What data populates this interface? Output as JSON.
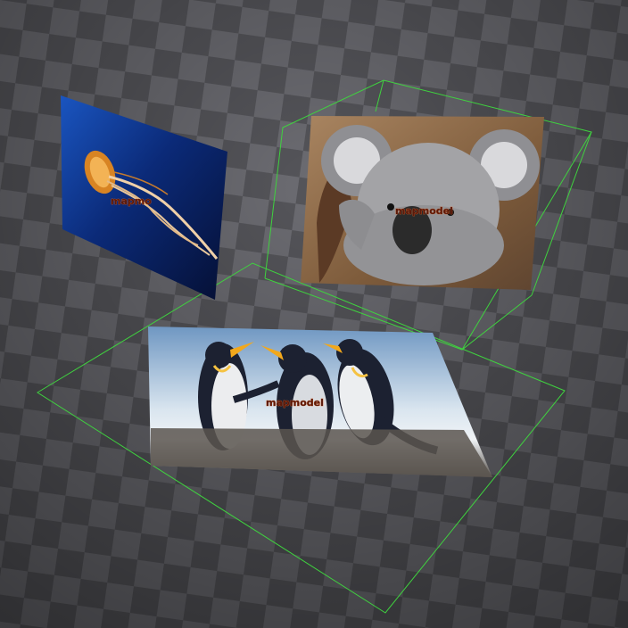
{
  "scene": {
    "floor_colors": {
      "light": "#6c6c72",
      "dark": "#37373b",
      "fade": "#1e1e22"
    },
    "selection_color": "#3fd23f",
    "label_fill": "#5a1a0c",
    "label_outline": "#d8632a"
  },
  "models": [
    {
      "id": "jellyfish",
      "label": "mapmo",
      "picture": "jellyfish-photo",
      "colors": {
        "bg_top": "#123a8a",
        "bg_bottom": "#06123a",
        "subject": "#e08a2a"
      }
    },
    {
      "id": "koala",
      "label": "mapmodel",
      "picture": "koala-photo",
      "colors": {
        "bg": "#8a6a48",
        "fur": "#9a9a9c",
        "nose": "#2a2a2a"
      }
    },
    {
      "id": "penguins",
      "label": "mapmodel",
      "picture": "penguins-photo",
      "colors": {
        "sky": "#b9d3e8",
        "ground": "#5c5650",
        "body": "#1d2130",
        "belly": "#e9ecef",
        "beak": "#f2a81c"
      }
    }
  ]
}
